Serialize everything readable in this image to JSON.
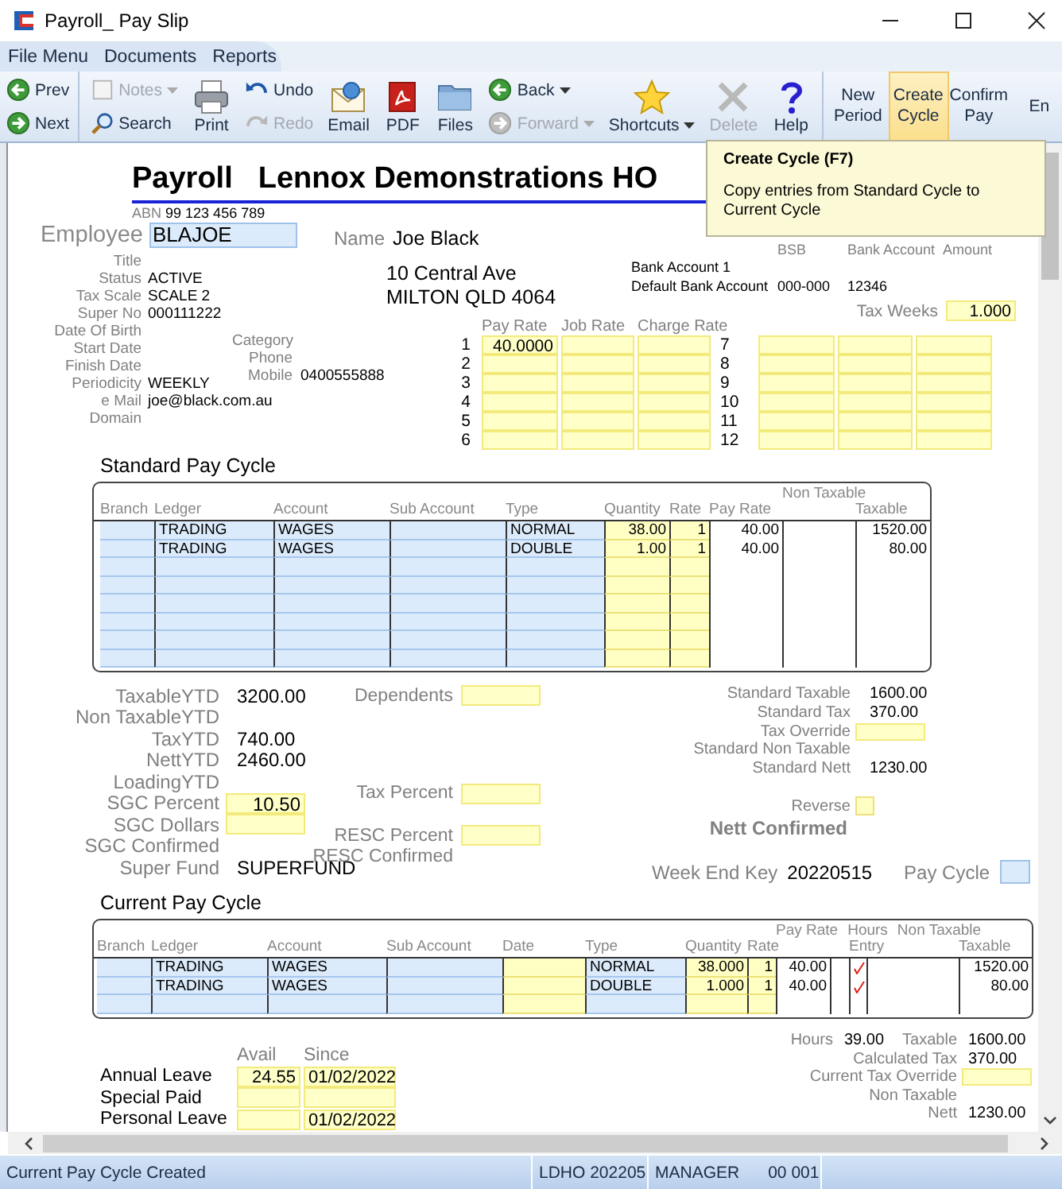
{
  "window": {
    "title": "Payroll_ Pay Slip"
  },
  "menu": [
    {
      "label": "File Menu"
    },
    {
      "label": "Documents"
    },
    {
      "label": "Reports"
    }
  ],
  "toolbar": [
    {
      "kind": "stack",
      "items": [
        {
          "label": "Prev",
          "disabled": false,
          "dropdown": false
        },
        {
          "label": "Next",
          "disabled": false,
          "dropdown": false
        }
      ]
    },
    {
      "kind": "stack",
      "items": [
        {
          "label": "Notes",
          "disabled": true,
          "dropdown": true
        },
        {
          "label": "Search",
          "disabled": false,
          "dropdown": false
        }
      ]
    },
    {
      "kind": "large",
      "items": [
        {
          "label": "Print",
          "disabled": false,
          "dropdown": false
        }
      ]
    },
    {
      "kind": "stack",
      "items": [
        {
          "label": "Undo",
          "disabled": false,
          "dropdown": false
        },
        {
          "label": "Redo",
          "disabled": true,
          "dropdown": false
        }
      ]
    },
    {
      "kind": "large",
      "items": [
        {
          "label": "Email",
          "disabled": false,
          "dropdown": false
        }
      ]
    },
    {
      "kind": "large",
      "items": [
        {
          "label": "PDF",
          "disabled": false,
          "dropdown": false
        }
      ]
    },
    {
      "kind": "large",
      "items": [
        {
          "label": "Files",
          "disabled": false,
          "dropdown": false
        }
      ]
    },
    {
      "kind": "stack",
      "items": [
        {
          "label": "Back",
          "disabled": false,
          "dropdown": true
        },
        {
          "label": "Forward",
          "disabled": true,
          "dropdown": true
        }
      ]
    },
    {
      "kind": "large",
      "items": [
        {
          "label": "Shortcuts",
          "disabled": false,
          "dropdown": true
        }
      ]
    },
    {
      "kind": "large",
      "items": [
        {
          "label": "Delete",
          "disabled": true,
          "dropdown": false
        }
      ]
    },
    {
      "kind": "large",
      "items": [
        {
          "label": "Help",
          "disabled": false,
          "dropdown": false
        }
      ]
    },
    {
      "kind": "text",
      "items": [
        {
          "label": "New Period",
          "selected": false
        },
        {
          "label": "Create Cycle",
          "selected": true
        },
        {
          "label": "Confirm Pay",
          "selected": false
        },
        {
          "label": "En",
          "selected": false
        }
      ]
    }
  ],
  "tooltip": {
    "title": "Create Cycle (F7)",
    "text": "Copy entries from Standard Cycle to Current Cycle"
  },
  "header": {
    "title": "Payroll",
    "company": "Lennox Demonstrations HO",
    "abn_label": "ABN",
    "abn": "99 123 456 789"
  },
  "employee": {
    "label": "Employee",
    "code": "BLAJOE",
    "name_label": "Name",
    "name": "Joe Black",
    "details": [
      {
        "label": "Title"
      },
      {
        "label": "Status",
        "value": "ACTIVE"
      },
      {
        "label": "Tax Scale",
        "value": "SCALE 2"
      },
      {
        "label": "Super No",
        "value": "000111222"
      },
      {
        "label": "Date Of Birth"
      },
      {
        "label": "Start Date"
      },
      {
        "label": "Finish Date"
      },
      {
        "label": "Periodicity",
        "value": "WEEKLY"
      },
      {
        "label": "e Mail",
        "value": "joe@black.com.au"
      },
      {
        "label": "Domain"
      }
    ],
    "contact": [
      {
        "label": "Category"
      },
      {
        "label": "Phone"
      },
      {
        "label": "Mobile",
        "value": "0400555888"
      }
    ],
    "address": [
      "10 Central Ave",
      "MILTON QLD 4064"
    ]
  },
  "bank": {
    "columns": [
      "BSB",
      "Bank Account",
      "Amount"
    ],
    "rows": [
      {
        "label": "Bank Account 1"
      },
      {
        "label": "Default Bank Account",
        "bsb": "000-000",
        "account": "12346"
      }
    ]
  },
  "tax_weeks": {
    "label": "Tax Weeks",
    "value": "1.000"
  },
  "rates": {
    "columns": [
      "Pay Rate",
      "Job Rate",
      "Charge Rate"
    ],
    "rows": [
      {
        "number": "1",
        "values": [
          "40.0000"
        ]
      },
      {
        "number": "2"
      },
      {
        "number": "3"
      },
      {
        "number": "4"
      },
      {
        "number": "5"
      },
      {
        "number": "6"
      },
      {
        "number": "7"
      },
      {
        "number": "8"
      },
      {
        "number": "9"
      },
      {
        "number": "10"
      },
      {
        "number": "11"
      },
      {
        "number": "12"
      }
    ]
  },
  "standard_cycle": {
    "title": "Standard Pay Cycle",
    "columns": [
      {
        "label": "Branch",
        "kind": "entry"
      },
      {
        "label": "Ledger",
        "kind": "entry"
      },
      {
        "label": "Account",
        "kind": "entry"
      },
      {
        "label": "Sub Account",
        "kind": "entry"
      },
      {
        "label": "Type",
        "kind": "entry"
      },
      {
        "label": "Quantity",
        "kind": "input"
      },
      {
        "label": "Rate",
        "kind": "input"
      },
      {
        "label": "Pay Rate",
        "kind": "value"
      },
      {
        "over": "Non Taxable",
        "kind": "value"
      },
      {
        "label": "Taxable",
        "kind": "value"
      }
    ],
    "rows": [
      {
        "cells": [
          null,
          "TRADING",
          "WAGES",
          null,
          "NORMAL",
          "38.00",
          "1",
          "40.00",
          null,
          "1520.00"
        ]
      },
      {
        "cells": [
          null,
          "TRADING",
          "WAGES",
          null,
          "DOUBLE",
          "1.00",
          "1",
          "40.00",
          null,
          "80.00"
        ]
      },
      {},
      {},
      {},
      {},
      {},
      {}
    ]
  },
  "ytd": [
    {
      "label": "TaxableYTD",
      "kind": "text",
      "value": "3200.00"
    },
    {
      "label": "Non TaxableYTD",
      "kind": "text"
    },
    {
      "label": "TaxYTD",
      "kind": "text",
      "value": "740.00"
    },
    {
      "label": "NettYTD",
      "kind": "text",
      "value": "2460.00"
    },
    {
      "label": "LoadingYTD",
      "kind": "text"
    },
    {
      "label": "SGC Percent",
      "kind": "field",
      "value": "10.50"
    },
    {
      "label": "SGC Dollars",
      "kind": "field"
    },
    {
      "label": "SGC Confirmed",
      "kind": "text"
    },
    {
      "label": "Super Fund",
      "kind": "text",
      "value": "SUPERFUND"
    }
  ],
  "tax_fields": [
    {
      "label": "Dependents",
      "kind": "field"
    },
    {
      "label": "Tax Percent",
      "kind": "field"
    },
    {
      "label": "RESC Percent",
      "kind": "field"
    },
    {
      "label": "RESC Confirmed",
      "kind": "text"
    }
  ],
  "standard_totals": [
    {
      "label": "Standard Taxable",
      "kind": "text",
      "value": "1600.00"
    },
    {
      "label": "Standard Tax",
      "kind": "text",
      "value": "370.00"
    },
    {
      "label": "Tax Override",
      "kind": "field"
    },
    {
      "label": "Standard Non Taxable",
      "kind": "text"
    },
    {
      "label": "Standard Nett",
      "kind": "text",
      "value": "1230.00"
    }
  ],
  "reverse": {
    "label": "Reverse",
    "checked": false
  },
  "nett_confirmed": "Nett Confirmed",
  "week_end": {
    "label": "Week End Key",
    "value": "20220515"
  },
  "pay_cycle": {
    "label": "Pay Cycle"
  },
  "current_cycle": {
    "title": "Current Pay Cycle",
    "columns": [
      {
        "label": "Branch",
        "kind": "entry"
      },
      {
        "label": "Ledger",
        "kind": "entry"
      },
      {
        "label": "Account",
        "kind": "entry"
      },
      {
        "label": "Sub Account",
        "kind": "entry"
      },
      {
        "label": "Date",
        "kind": "input"
      },
      {
        "label": "Type",
        "kind": "entry"
      },
      {
        "label": "Quantity",
        "kind": "input"
      },
      {
        "label": "Rate",
        "kind": "input"
      },
      {
        "over": "Pay Rate",
        "kind": "value"
      },
      {
        "kind": "value"
      },
      {
        "over": "Hours",
        "label": "Entry",
        "kind": "check"
      },
      {
        "over": "Non Taxable",
        "kind": "value"
      },
      {
        "label": "Taxable",
        "kind": "value"
      }
    ],
    "rows": [
      {
        "cells": [
          null,
          "TRADING",
          "WAGES",
          null,
          null,
          "NORMAL",
          "38.000",
          "1",
          "40.00",
          null,
          true,
          null,
          "1520.00"
        ]
      },
      {
        "cells": [
          null,
          "TRADING",
          "WAGES",
          null,
          null,
          "DOUBLE",
          "1.000",
          "1",
          "40.00",
          null,
          true,
          null,
          "80.00"
        ]
      },
      {
        "cells": [
          null,
          null,
          null,
          null,
          null,
          null,
          null,
          null,
          null,
          null,
          false,
          null,
          null
        ]
      }
    ]
  },
  "current_totals": {
    "hours_label": "Hours",
    "hours": "39.00",
    "taxable_label": "Taxable",
    "taxable": "1600.00",
    "rows": [
      {
        "label": "Calculated Tax",
        "kind": "text",
        "value": "370.00"
      },
      {
        "label": "Current Tax Override",
        "kind": "field"
      },
      {
        "label": "Non Taxable",
        "kind": "text"
      },
      {
        "label": "Nett",
        "kind": "text",
        "value": "1230.00"
      }
    ]
  },
  "leave": {
    "columns": [
      "Avail",
      "Since"
    ],
    "rows": [
      {
        "label": "Annual Leave",
        "avail": "24.55",
        "since": "01/02/2022"
      },
      {
        "label": "Special Paid"
      },
      {
        "label": "Personal Leave",
        "since": "01/02/2022"
      }
    ]
  },
  "status_bar": [
    {
      "texts": [
        "Current Pay Cycle Created"
      ]
    },
    {
      "texts": [
        "LDHO 202205"
      ]
    },
    {
      "texts": [
        "MANAGER",
        "00 001"
      ]
    }
  ]
}
